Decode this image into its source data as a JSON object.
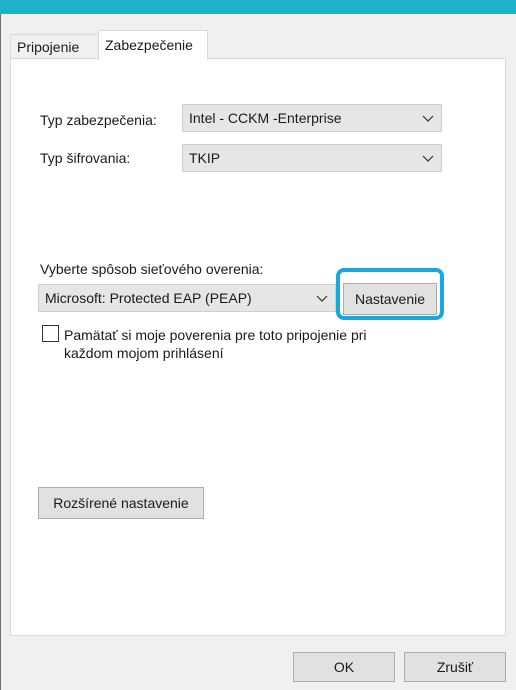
{
  "tabs": [
    {
      "label": "Pripojenie",
      "active": false
    },
    {
      "label": "Zabezpečenie",
      "active": true
    }
  ],
  "security": {
    "type_label": "Typ zabezpečenia:",
    "type_value": "Intel - CCKM -Enterprise",
    "encryption_label": "Typ šifrovania:",
    "encryption_value": "TKIP"
  },
  "auth": {
    "method_label": "Vyberte spôsob sieťového overenia:",
    "method_value": "Microsoft: Protected EAP (PEAP)",
    "settings_button": "Nastavenie"
  },
  "remember": {
    "checked": false,
    "line1": "Pamätať si moje poverenia pre toto pripojenie pri",
    "line2": "každom mojom prihlásení"
  },
  "advanced_button": "Rozšírené nastavenie",
  "footer": {
    "ok": "OK",
    "cancel": "Zrušiť"
  },
  "colors": {
    "titlebar": "#1eb4c8",
    "highlight": "#16a9e0"
  },
  "icons": {
    "dropdown": "chevron-down-icon"
  }
}
